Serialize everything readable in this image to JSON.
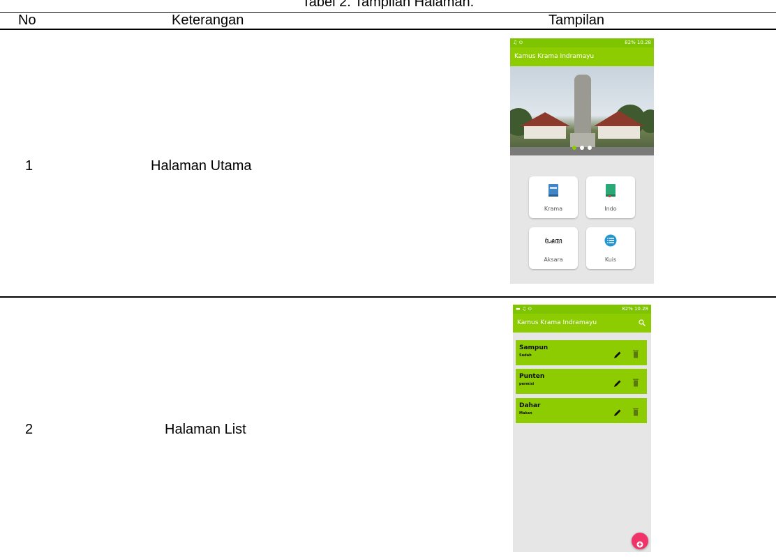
{
  "caption": "Tabel 2. Tampilan Halaman.",
  "headers": {
    "no": "No",
    "keterangan": "Keterangan",
    "tampilan": "Tampilan"
  },
  "rows": [
    {
      "no": "1",
      "keterangan": "Halaman Utama"
    },
    {
      "no": "2",
      "keterangan": "Halaman List"
    }
  ],
  "phone": {
    "status_left_1": "♫ ⊙",
    "status_left_2": "▬ ♫ ⊙",
    "status_right": "82% 10.28",
    "app_title": "Kamus Krama Indramayu",
    "menu": [
      {
        "label": "Krama",
        "icon": "blue-book-icon"
      },
      {
        "label": "Indo",
        "icon": "green-book-icon"
      },
      {
        "label": "Aksara",
        "icon": "aksara-script-icon",
        "glyph": "ꦄꦩ"
      },
      {
        "label": "Kuis",
        "icon": "quiz-list-icon"
      }
    ],
    "list": [
      {
        "word": "Sampun",
        "meaning": "Sudah"
      },
      {
        "word": "Punten",
        "meaning": "permisi"
      },
      {
        "word": "Dahar",
        "meaning": "Makan"
      }
    ]
  },
  "colors": {
    "primary": "#8ccc00",
    "fab": "#f0346a",
    "screen_bg": "#e6e6e6"
  }
}
